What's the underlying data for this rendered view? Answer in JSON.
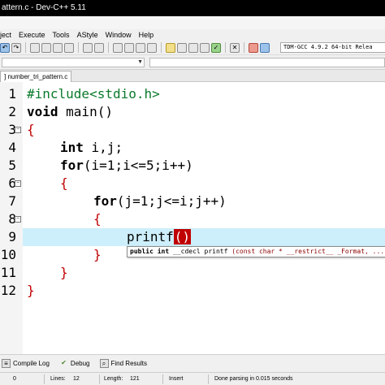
{
  "window": {
    "title": "attern.c - Dev-C++ 5.11"
  },
  "menu": {
    "items": [
      "ject",
      "Execute",
      "Tools",
      "AStyle",
      "Window",
      "Help"
    ]
  },
  "toolbar": {
    "compiler": "TDM-GCC 4.9.2 64-bit Relea"
  },
  "tab": {
    "label": "] number_tri_pattern.c"
  },
  "editor": {
    "line_numbers": [
      "1",
      "2",
      "3",
      "4",
      "5",
      "6",
      "7",
      "8",
      "9",
      "10",
      "11",
      "12"
    ],
    "lines": {
      "l1_directive": "#include<stdio.h>",
      "l2_void": "void",
      "l2_rest": " main()",
      "l3": "{",
      "l4_kw": "int",
      "l4_rest": " i,j;",
      "l5_kw": "for",
      "l5_rest": "(i=1;i<=5;i++)",
      "l6": "{",
      "l7_kw": "for",
      "l7_rest": "(j=1;j<=i;j++)",
      "l8": "{",
      "l9_fn": "printf",
      "l9_sel": "()",
      "l10": "}",
      "l11": "}",
      "l12": "}"
    },
    "highlight_color": "#cdeffb",
    "brace_color": "#c00000"
  },
  "tooltip": {
    "kw1": "public",
    "kw2": "int",
    "cdecl": " __cdecl printf ",
    "params": "(const char * __restrict__ _Format, ...)"
  },
  "bottom": {
    "compile_log": "Compile Log",
    "debug": "Debug",
    "find_results": "Find Results"
  },
  "status": {
    "col": "0",
    "lines_label": "Lines:",
    "lines_value": "12",
    "length_label": "Length:",
    "length_value": "121",
    "mode": "Insert",
    "message": "Done parsing in 0.015 seconds"
  }
}
